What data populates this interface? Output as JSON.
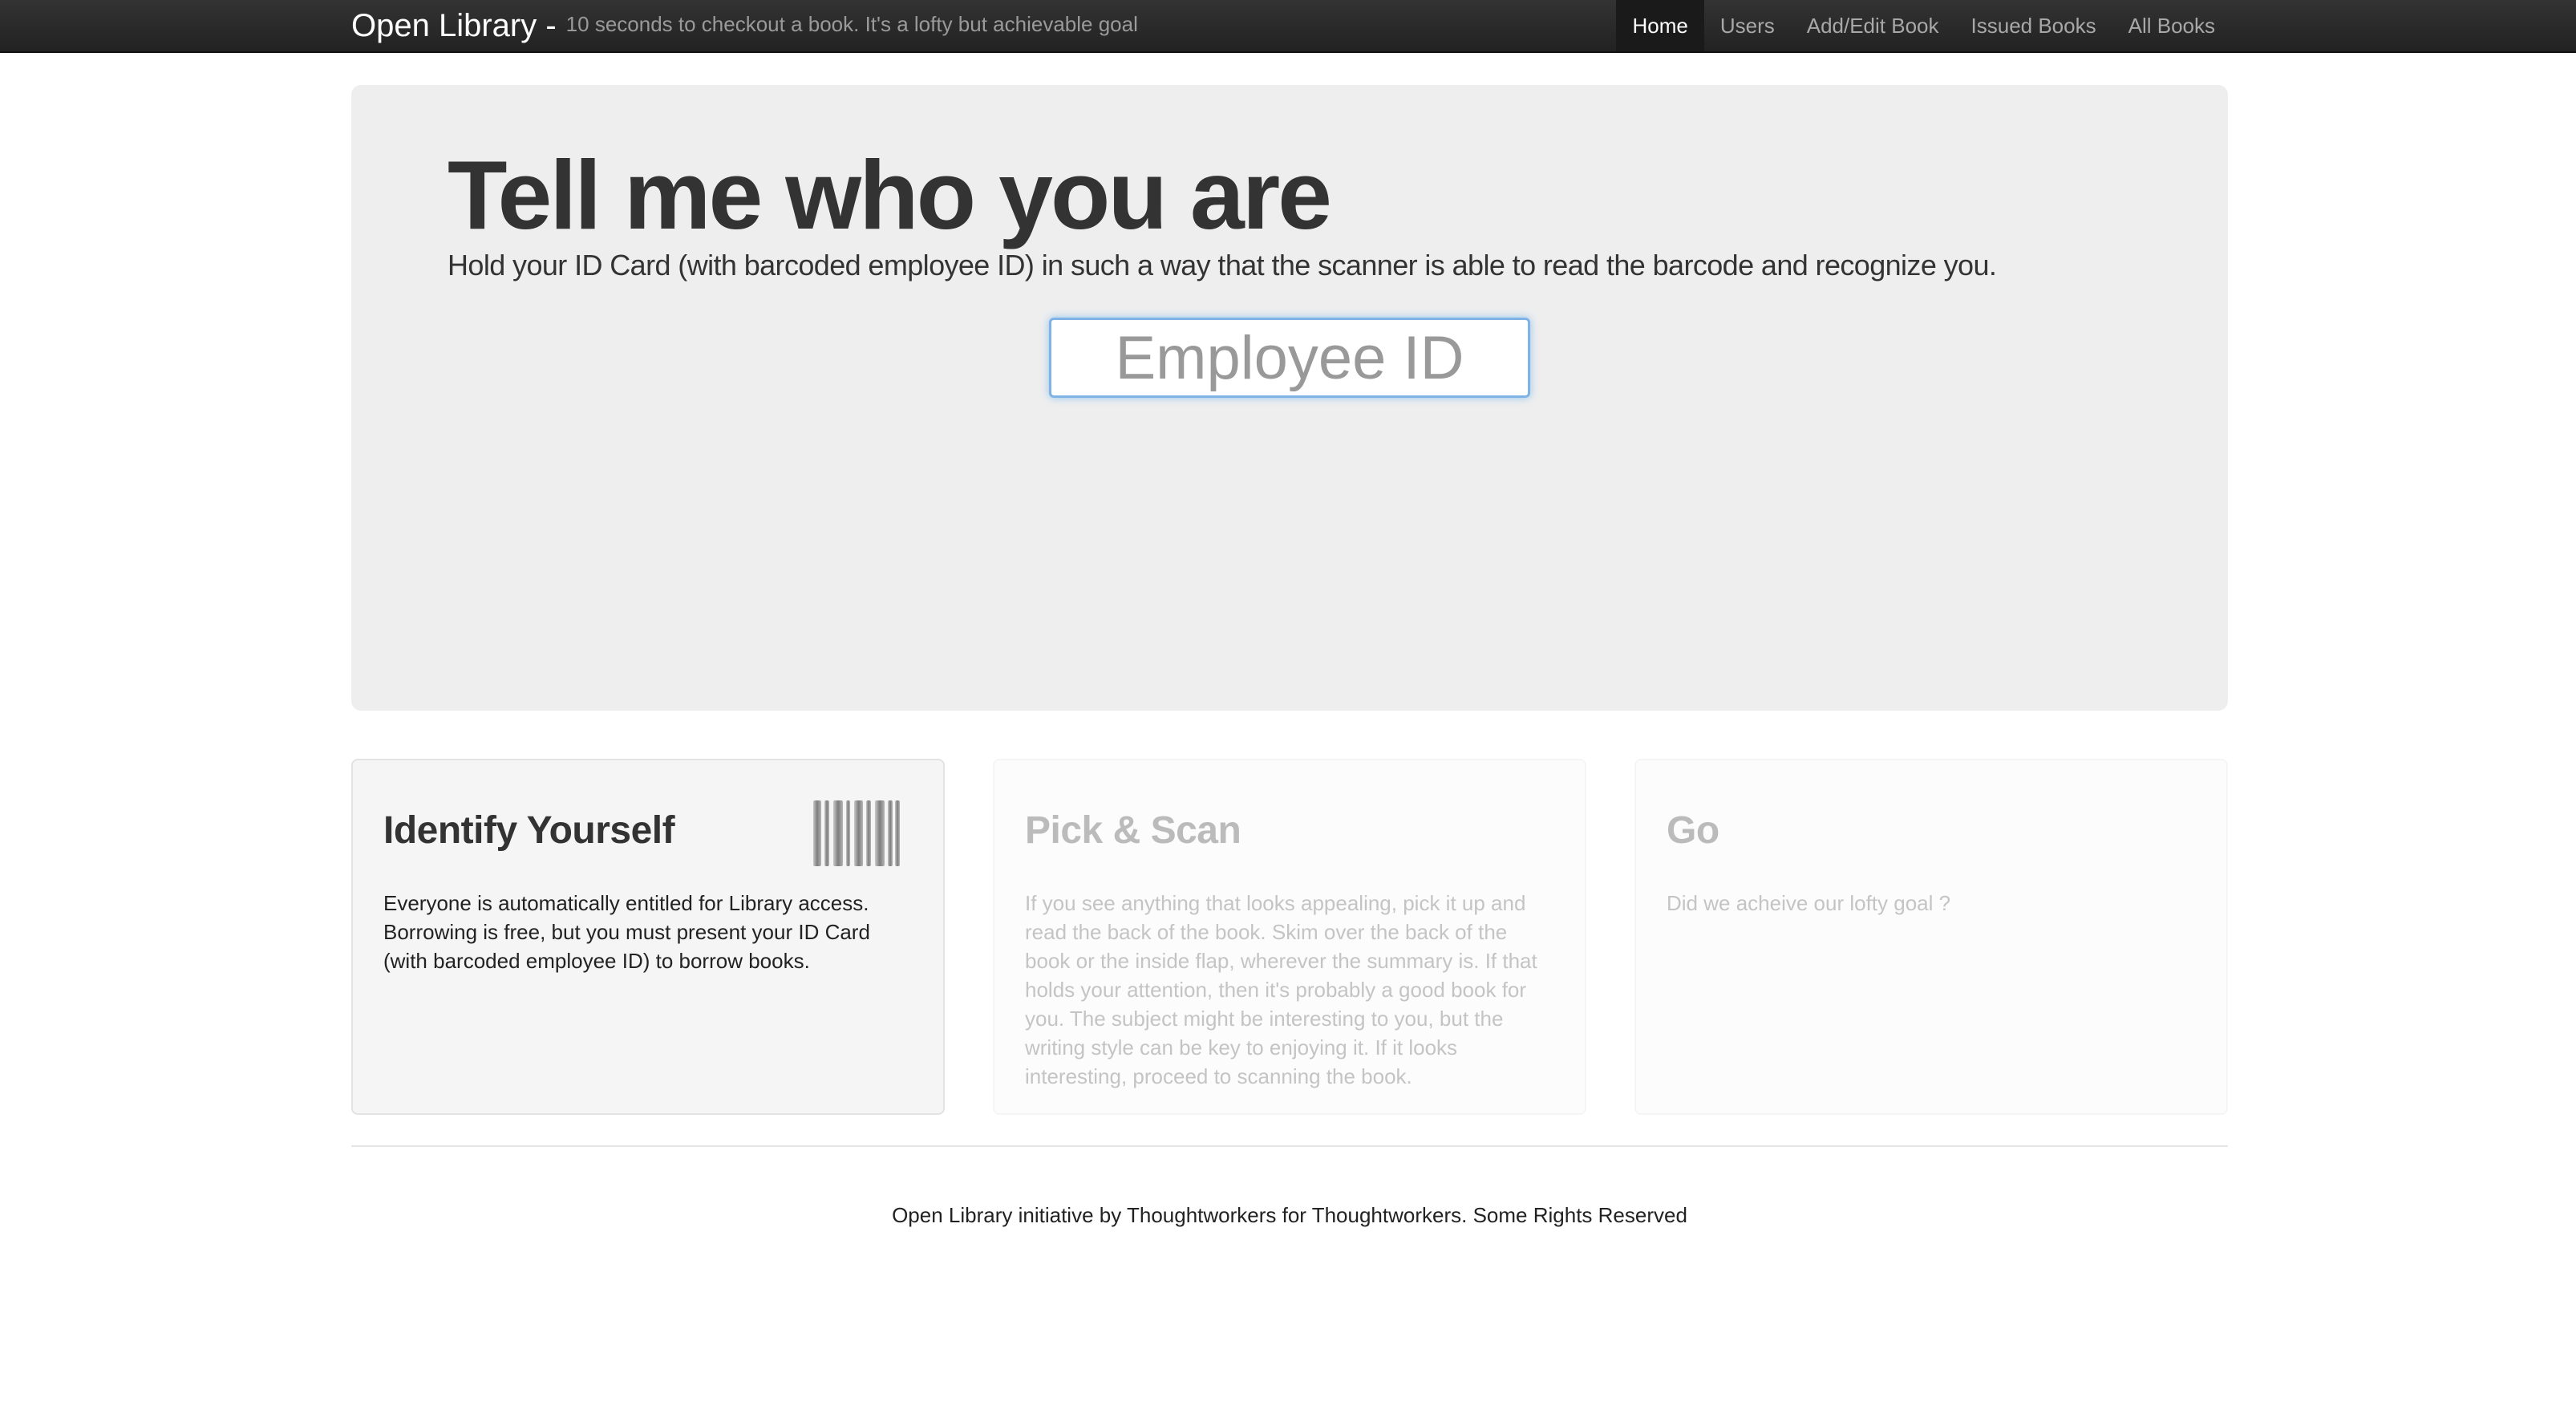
{
  "navbar": {
    "brand_name": "Open Library -",
    "tagline": "10 seconds to checkout a book. It's a lofty but achievable goal",
    "links": [
      {
        "label": "Home",
        "active": true
      },
      {
        "label": "Users",
        "active": false
      },
      {
        "label": "Add/Edit Book",
        "active": false
      },
      {
        "label": "Issued Books",
        "active": false
      },
      {
        "label": "All Books",
        "active": false
      }
    ]
  },
  "hero": {
    "title": "Tell me who you are",
    "subtitle": "Hold your ID Card (with barcoded employee ID) in such a way that the scanner is able to read the barcode and recognize you.",
    "employee_input": {
      "value": "",
      "placeholder": "Employee ID"
    }
  },
  "steps": [
    {
      "title": "Identify Yourself",
      "body": "Everyone is automatically entitled for Library access. Borrowing is free, but you must present your ID Card (with barcoded employee ID) to borrow books.",
      "icon": "barcode-icon",
      "active": true
    },
    {
      "title": "Pick & Scan",
      "body": "If you see anything that looks appealing, pick it up and read the back of the book. Skim over the back of the book or the inside flap, wherever the summary is. If that holds your attention, then it's probably a good book for you. The subject might be interesting to you, but the writing style can be key to enjoying it. If it looks interesting, proceed to scanning the book.",
      "active": false
    },
    {
      "title": "Go",
      "body": "Did we acheive our lofty goal ?",
      "active": false
    }
  ],
  "footer": {
    "text": "Open Library initiative by Thoughtworkers for Thoughtworkers. Some Rights Reserved"
  },
  "colors": {
    "navbar_bg": "#222222",
    "hero_bg": "#eeeeee",
    "input_focus": "#52a8ec",
    "active_text": "#333333",
    "inactive_text": "#bbbbbb"
  }
}
